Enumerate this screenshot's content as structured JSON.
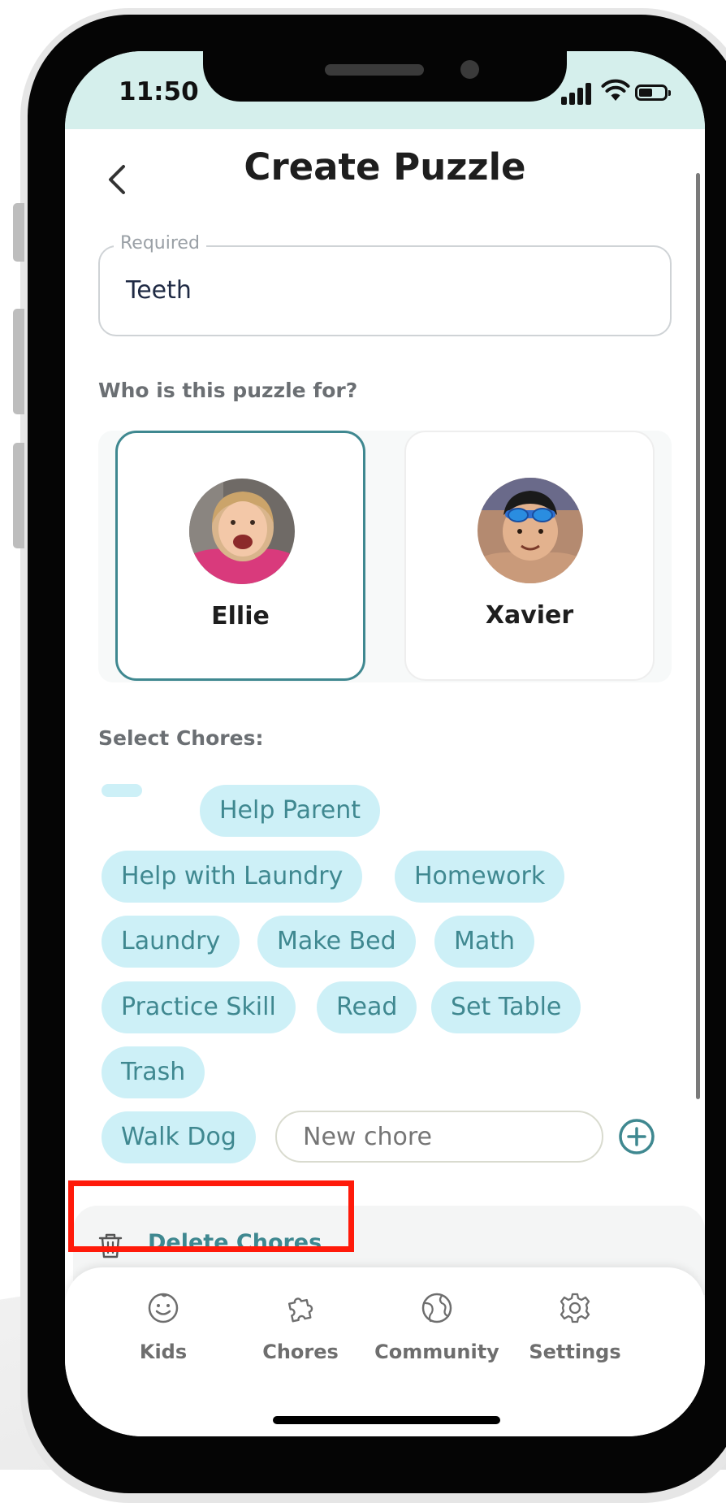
{
  "status_bar": {
    "time": "11:50"
  },
  "header": {
    "title": "Create Puzzle"
  },
  "name_field": {
    "label": "Required",
    "value": "Teeth"
  },
  "kids_section": {
    "label": "Who is this puzzle for?",
    "kids": [
      {
        "name": "Ellie",
        "selected": true
      },
      {
        "name": "Xavier",
        "selected": false
      }
    ]
  },
  "chores_section": {
    "label": "Select Chores:",
    "chores": [
      "Help Parent",
      "Help with Laundry",
      "Homework",
      "Laundry",
      "Make Bed",
      "Math",
      "Practice Skill",
      "Read",
      "Set Table",
      "Trash",
      "Walk Dog"
    ],
    "new_chore_placeholder": "New chore"
  },
  "delete_chores": {
    "label": "Delete Chores"
  },
  "highlight_color": "#ff1a0a",
  "accent_color": "#3f8890",
  "chip_color": "#cdf0f7",
  "bottom_nav": {
    "items": [
      {
        "label": "Kids",
        "icon": "smiley-face-icon"
      },
      {
        "label": "Chores",
        "icon": "puzzle-piece-icon"
      },
      {
        "label": "Community",
        "icon": "globe-icon"
      },
      {
        "label": "Settings",
        "icon": "gear-icon"
      }
    ]
  }
}
